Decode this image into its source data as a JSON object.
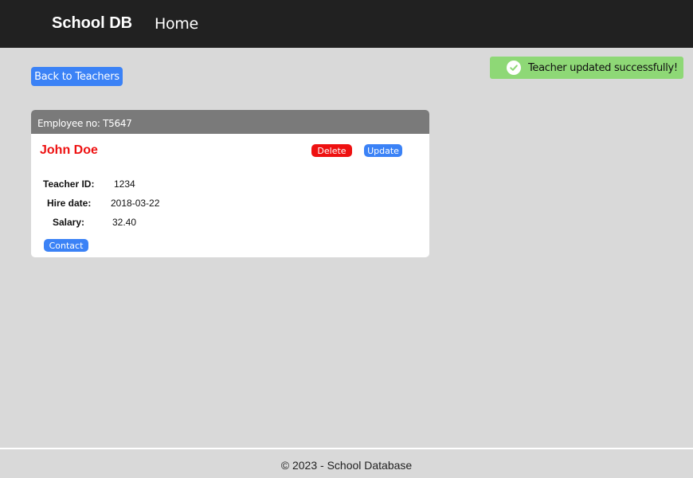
{
  "navbar": {
    "brand": "School DB",
    "links": [
      {
        "label": "Home"
      }
    ]
  },
  "actions": {
    "back_label": "Back to Teachers"
  },
  "toast": {
    "icon": "check-circle-icon",
    "message": "Teacher updated successfully!",
    "color": "#8ed876"
  },
  "card": {
    "header": "Employee no: T5647",
    "name": "John Doe",
    "delete_label": "Delete",
    "update_label": "Update",
    "contact_label": "Contact",
    "details": [
      {
        "label": "Teacher ID:",
        "value": "1234"
      },
      {
        "label": "Hire date:",
        "value": "2018-03-22"
      },
      {
        "label": "Salary:",
        "value": "32.40"
      }
    ]
  },
  "footer": {
    "text": "© 2023 - School Database"
  },
  "colors": {
    "navbar_bg": "#212121",
    "primary": "#3b82f6",
    "danger": "#ee1111",
    "page_bg": "#d9d9d9"
  }
}
